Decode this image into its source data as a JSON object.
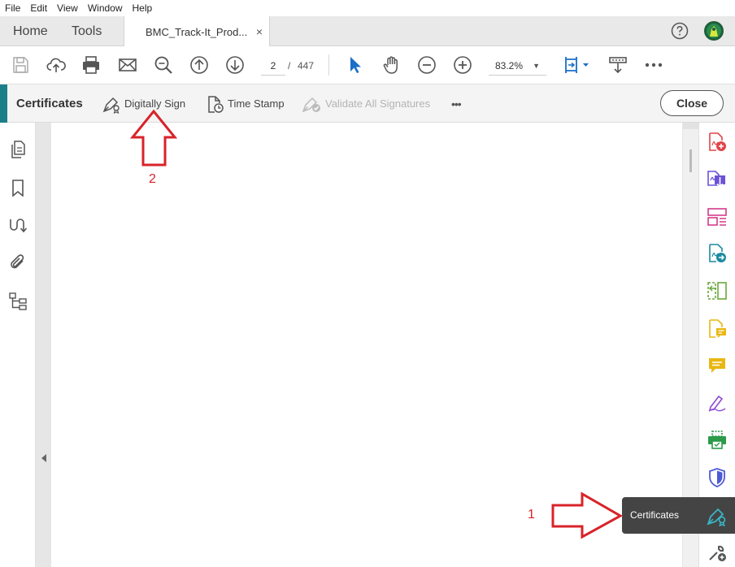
{
  "menu": [
    "File",
    "Edit",
    "View",
    "Window",
    "Help"
  ],
  "tabs": {
    "home": "Home",
    "tools": "Tools",
    "document": "BMC_Track-It_Prod...",
    "close_symbol": "×"
  },
  "toolbar": {
    "current_page": "2",
    "page_sep": "/",
    "total_pages": "447",
    "zoom": "83.2%",
    "zoom_caret": "▼"
  },
  "certificates_bar": {
    "title": "Certificates",
    "digitally_sign": "Digitally Sign",
    "time_stamp": "Time Stamp",
    "validate_all": "Validate All Signatures",
    "more": "•••",
    "close": "Close"
  },
  "tooltip": {
    "label": "Certificates"
  },
  "annotations": {
    "step1": "1",
    "step2": "2"
  },
  "colors": {
    "accent_teal": "#1b7f8a",
    "annotation_red": "#d8232a",
    "tooltip_bg": "#444444"
  },
  "icons": {
    "toolbar": [
      "save-icon",
      "upload-icon",
      "print-icon",
      "mail-icon",
      "zoom-search-icon",
      "page-up-icon",
      "page-down-icon",
      "select-cursor-icon",
      "hand-icon",
      "zoom-out-icon",
      "zoom-in-icon",
      "fit-page-icon",
      "scroll-mode-icon",
      "more-icon"
    ],
    "left_nav": [
      "pages-icon",
      "bookmark-icon",
      "link-icon",
      "attachment-icon",
      "tree-icon"
    ],
    "right_tools": [
      "create-pdf-icon",
      "export-pdf-icon",
      "organize-pages-icon",
      "send-pdf-icon",
      "compare-icon",
      "comment-file-icon",
      "comment-icon",
      "fill-sign-icon",
      "print-production-icon",
      "protect-icon",
      "certificates-icon",
      "more-tools-icon"
    ]
  }
}
